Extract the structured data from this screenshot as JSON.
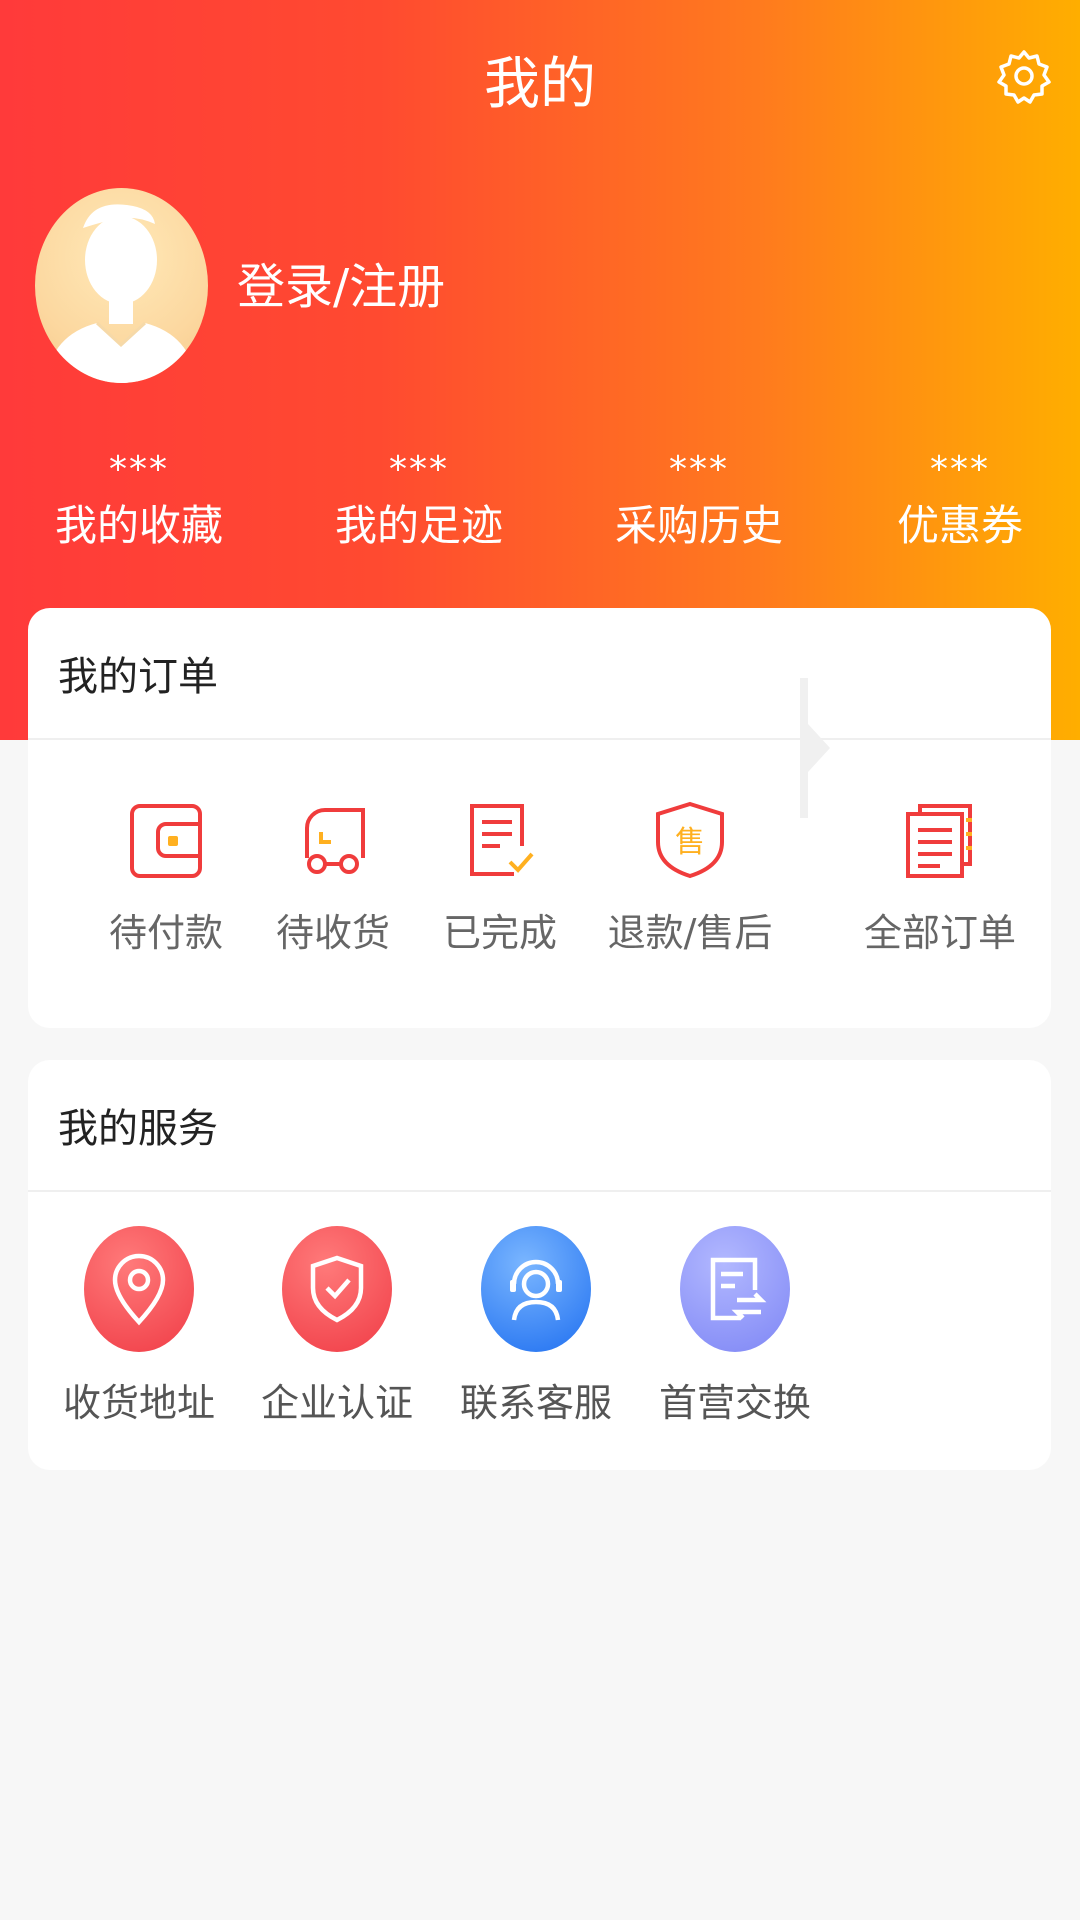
{
  "header": {
    "title": "我的"
  },
  "profile": {
    "login_label": "登录/注册"
  },
  "stats": [
    {
      "value": "***",
      "label": "我的收藏"
    },
    {
      "value": "***",
      "label": "我的足迹"
    },
    {
      "value": "***",
      "label": "采购历史"
    },
    {
      "value": "***",
      "label": "优惠券"
    }
  ],
  "orders": {
    "title": "我的订单",
    "items": [
      {
        "label": "待付款",
        "icon": "wallet-icon"
      },
      {
        "label": "待收货",
        "icon": "truck-icon"
      },
      {
        "label": "已完成",
        "icon": "document-check-icon"
      },
      {
        "label": "退款/售后",
        "icon": "after-sale-shield-icon"
      },
      {
        "label": "全部订单",
        "icon": "all-orders-icon"
      }
    ],
    "after_sale_badge": "售"
  },
  "services": {
    "title": "我的服务",
    "items": [
      {
        "label": "收货地址",
        "icon": "location-pin-icon"
      },
      {
        "label": "企业认证",
        "icon": "shield-check-icon"
      },
      {
        "label": "联系客服",
        "icon": "customer-service-icon"
      },
      {
        "label": "首营交换",
        "icon": "document-exchange-icon"
      }
    ]
  },
  "colors": {
    "header_start": "#ff3a3a",
    "header_end": "#ffae00",
    "order_icon_red": "#f03c3c",
    "order_icon_accent": "#ffb020"
  }
}
